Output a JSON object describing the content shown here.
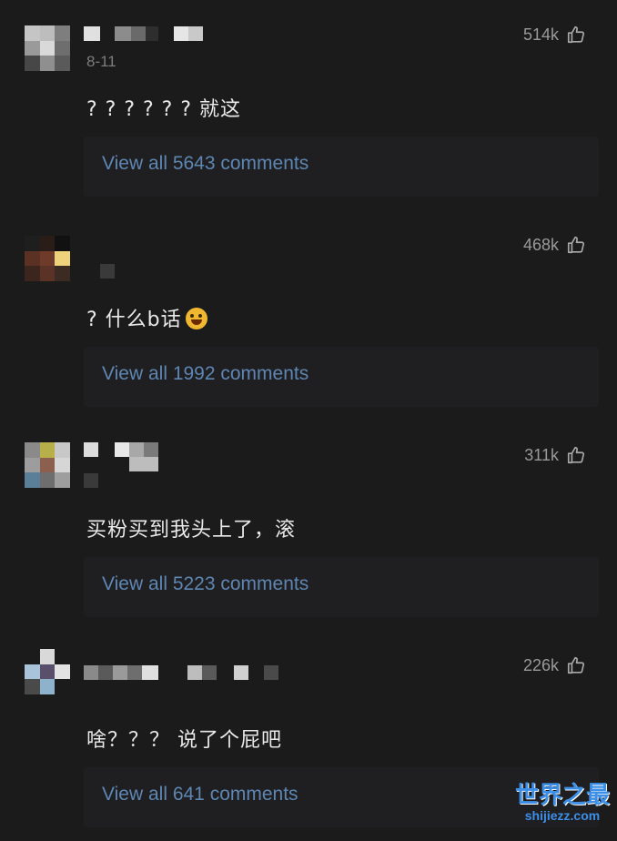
{
  "comments": [
    {
      "date": "8-11",
      "likes": "514k",
      "text": "? ? ? ? ? ? 就这",
      "replies_label": "View all 5643 comments",
      "avatar_colors": [
        "#c5c5c5",
        "#bdbdbd",
        "#7e7e7e",
        "#9a9a9a",
        "#d9d9d9",
        "#6e6e6e",
        "#474747",
        "#8f8f8f",
        "#5a5a5a"
      ]
    },
    {
      "date": "",
      "likes": "468k",
      "text": "? 什么b话",
      "replies_label": "View all 1992 comments",
      "avatar_colors": [
        "#1e1e1e",
        "#2a1d18",
        "#111111",
        "#5b3124",
        "#6e3a2a",
        "#efd37c",
        "#3b251d",
        "#5a3326",
        "#3c2b22"
      ]
    },
    {
      "date": "",
      "likes": "311k",
      "text": "买粉买到我头上了，滚",
      "replies_label": "View all 5223 comments",
      "avatar_colors": [
        "#8a8a8a",
        "#b7b04a",
        "#c8c8c8",
        "#9d9d9d",
        "#8c5f4f",
        "#d6d6d6",
        "#5b7f99",
        "#6e6e6e",
        "#9e9e9e"
      ]
    },
    {
      "date": "",
      "likes": "226k",
      "text": "啥？？？ 说了个屁吧",
      "replies_label": "View all 641 comments",
      "avatar_colors": [
        "#1b1b1c",
        "#d9d9d9",
        "#1b1b1c",
        "#a8c3da",
        "#5a4f6b",
        "#e3e3e3",
        "#4a4a4a",
        "#8fb2cc",
        "#1b1b1c"
      ]
    }
  ],
  "watermark": {
    "top": "世界之最",
    "bottom": "shijiezz.com"
  },
  "icons": {
    "like": "thumbs-up-icon"
  },
  "colors": {
    "background": "#1b1b1c",
    "link": "#5e86b3",
    "text": "#e9e9e9",
    "muted": "#9a9a9a"
  }
}
